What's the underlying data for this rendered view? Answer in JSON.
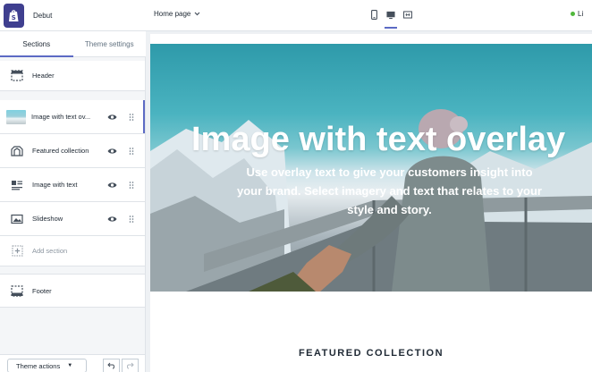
{
  "app": {
    "store_name": "Debut"
  },
  "sidebar": {
    "tabs": [
      {
        "label": "Sections",
        "active": true
      },
      {
        "label": "Theme settings",
        "active": false
      }
    ],
    "sections": [
      {
        "label": "Header",
        "icon": "header-icon"
      },
      {
        "label": "Image with text ov...",
        "icon": "image-thumbnail",
        "selected": true
      },
      {
        "label": "Featured collection",
        "icon": "collection-icon"
      },
      {
        "label": "Image with text",
        "icon": "image-text-icon"
      },
      {
        "label": "Slideshow",
        "icon": "slideshow-icon"
      },
      {
        "label": "Add section",
        "icon": "add-section-icon"
      },
      {
        "label": "Footer",
        "icon": "footer-icon"
      }
    ],
    "theme_actions_label": "Theme actions"
  },
  "toolbar": {
    "page_select": "Home page",
    "devices": [
      "mobile",
      "desktop",
      "fullscreen"
    ],
    "active_device": "desktop",
    "status_text": "Li"
  },
  "preview": {
    "hero_title": "Image with text overlay",
    "hero_text": "Use overlay text to give your customers insight into your brand. Select imagery and text that relates to your style and story.",
    "featured_heading": "FEATURED COLLECTION"
  },
  "colors": {
    "accent": "#5c6ac4",
    "logo_bg": "#3f3f8f",
    "live_dot": "#50b83c"
  }
}
